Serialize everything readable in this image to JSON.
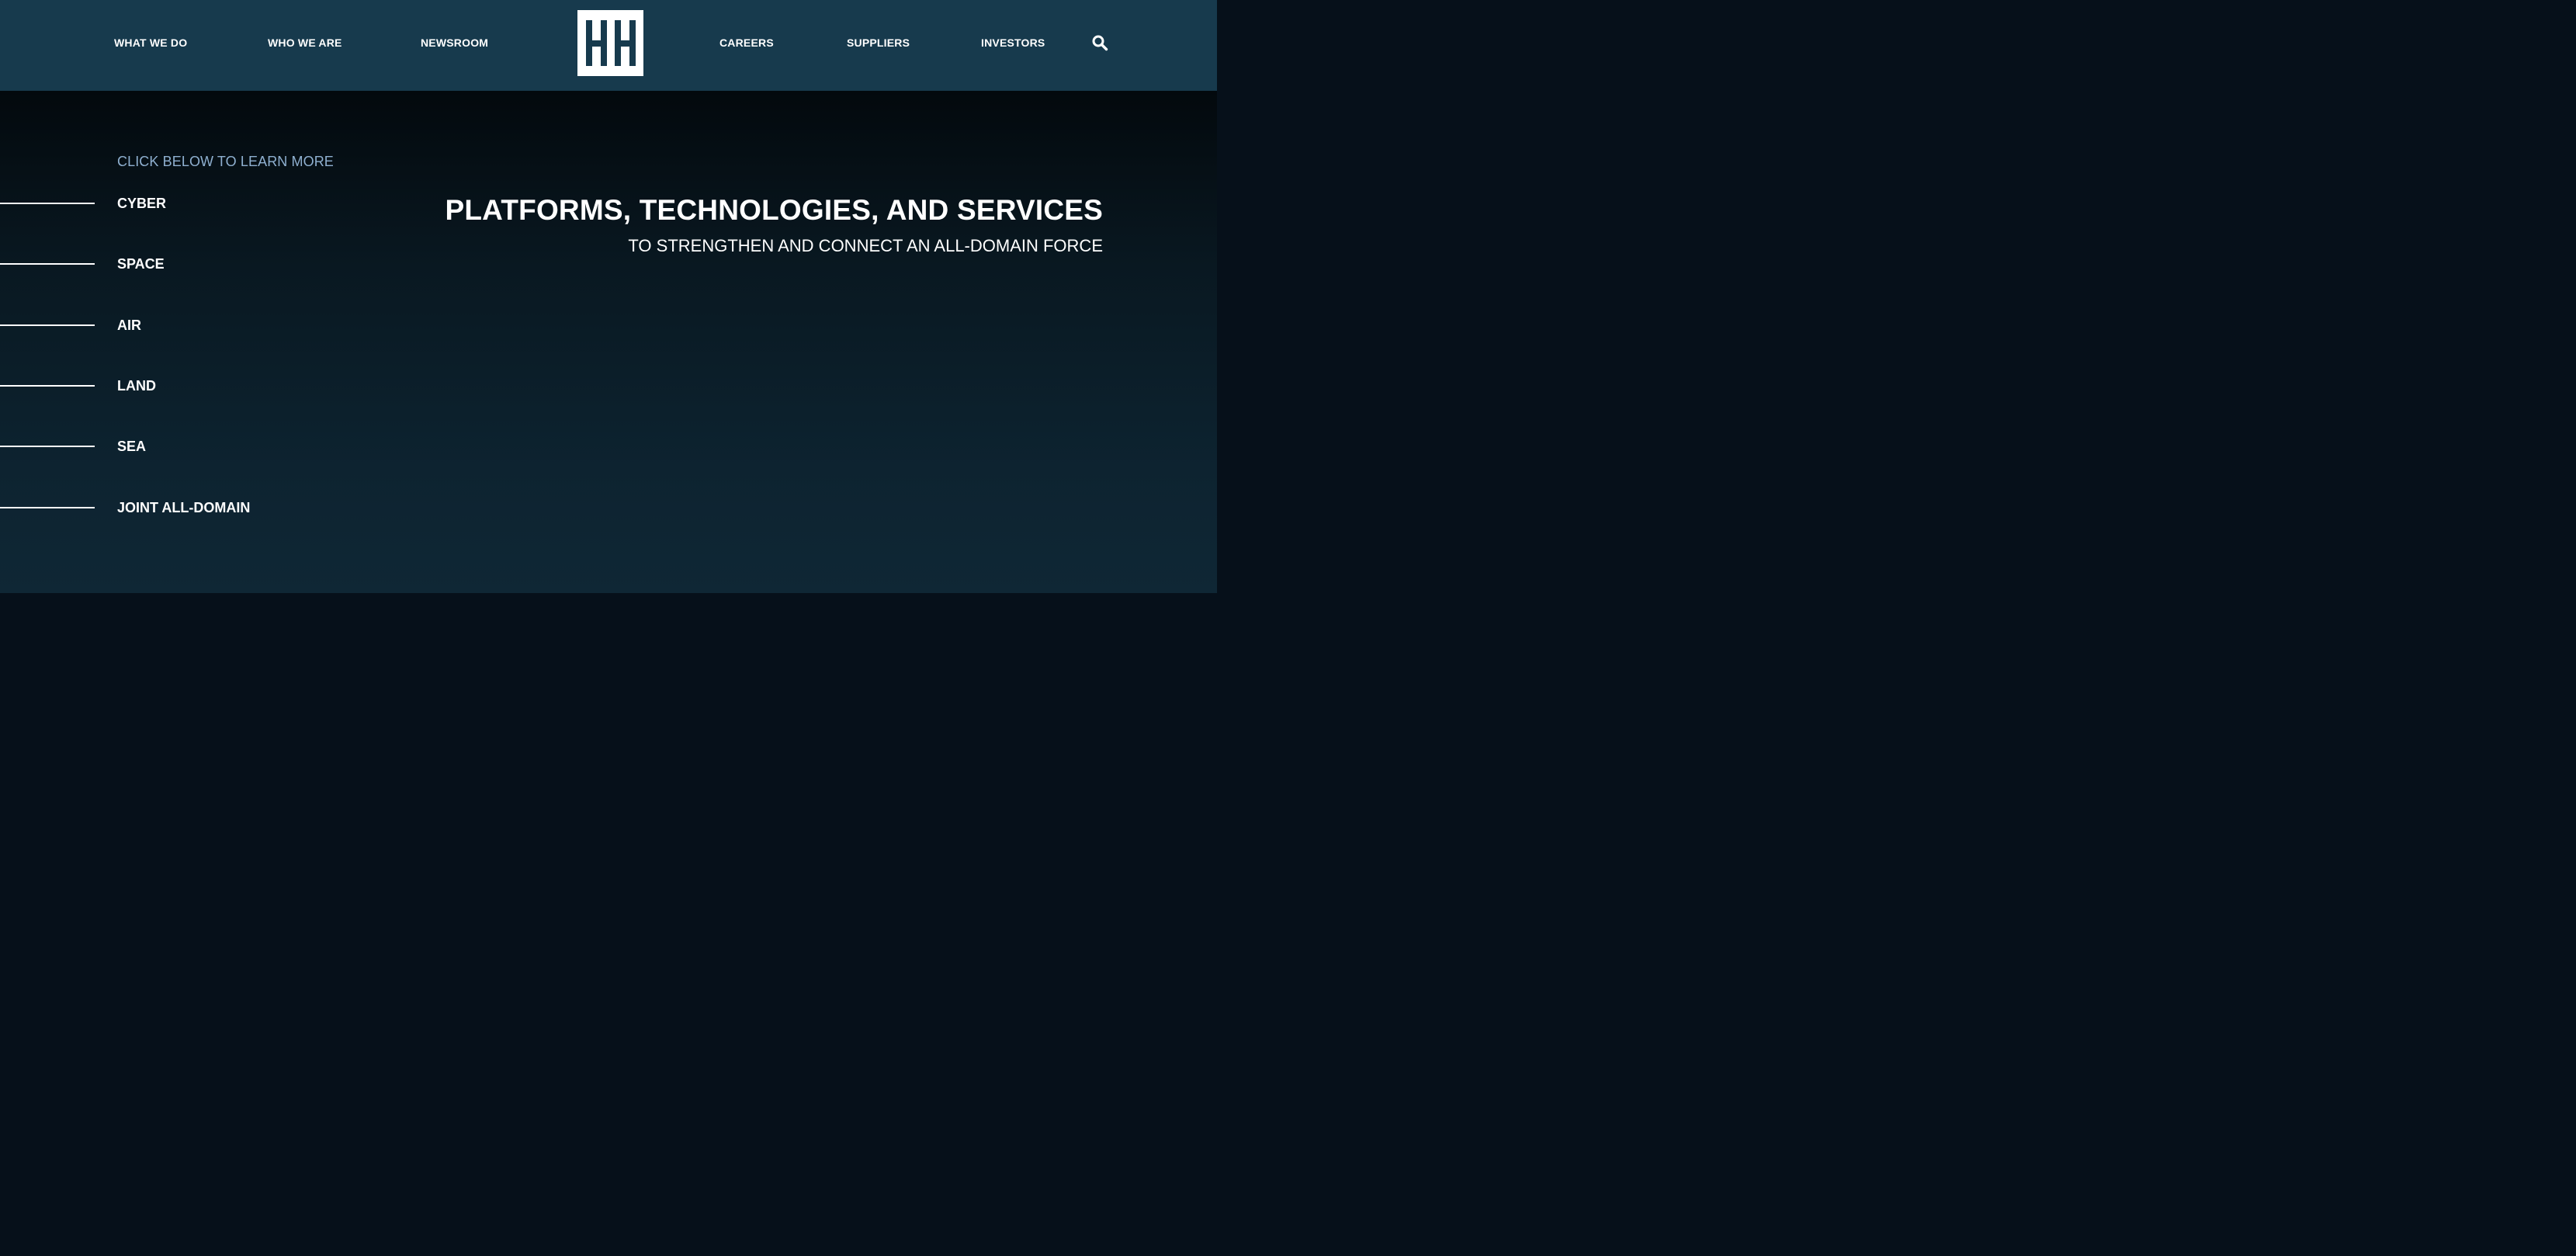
{
  "header": {
    "nav_left": [
      {
        "label": "WHAT WE DO"
      },
      {
        "label": "WHO WE ARE"
      },
      {
        "label": "NEWSROOM"
      }
    ],
    "nav_right": [
      {
        "label": "CAREERS"
      },
      {
        "label": "SUPPLIERS"
      },
      {
        "label": "INVESTORS"
      }
    ],
    "logo": {
      "icon": "company-logo-hh-icon"
    },
    "search": {
      "icon": "search-icon"
    }
  },
  "hero": {
    "intro": "CLICK BELOW TO LEARN MORE",
    "domains": [
      {
        "label": "CYBER"
      },
      {
        "label": "SPACE"
      },
      {
        "label": "AIR"
      },
      {
        "label": "LAND"
      },
      {
        "label": "SEA"
      },
      {
        "label": "JOINT ALL-DOMAIN"
      }
    ],
    "title": "PLATFORMS, TECHNOLOGIES, AND SERVICES",
    "subtitle": "TO STRENGTHEN AND CONNECT AN ALL-DOMAIN FORCE"
  },
  "colors": {
    "header_bg": "#173a4d",
    "hero_bg_top": "#03090d",
    "hero_bg_bottom": "#0f2735",
    "intro_text": "#8fb0d0",
    "text": "#ffffff",
    "logo_ink": "#173a4d"
  }
}
